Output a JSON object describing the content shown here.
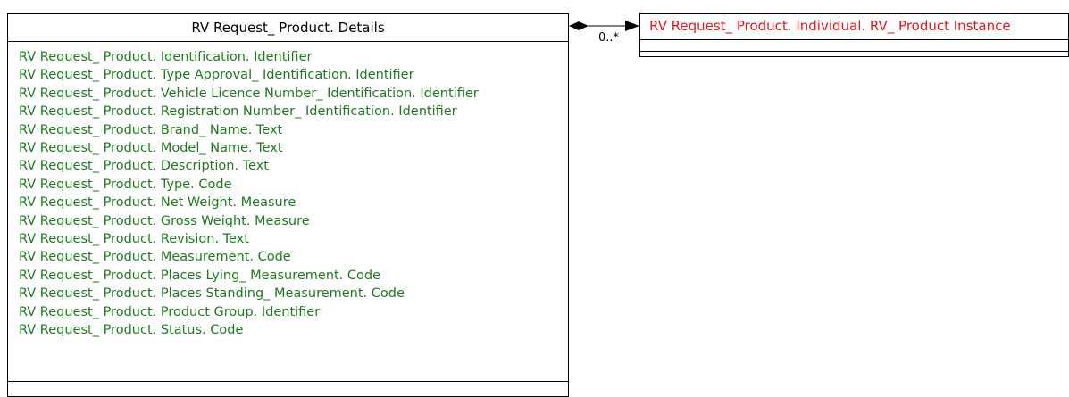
{
  "colors": {
    "attribute": "#1e7a1e",
    "target_class": "#e8141a",
    "line": "#000000"
  },
  "main_class": {
    "name": "RV Request_ Product. Details",
    "attributes": [
      "RV Request_ Product. Identification. Identifier",
      "RV Request_ Product. Type Approval_ Identification. Identifier",
      "RV Request_ Product. Vehicle Licence Number_ Identification. Identifier",
      "RV Request_ Product. Registration Number_ Identification. Identifier",
      "RV Request_ Product. Brand_ Name. Text",
      "RV Request_ Product. Model_ Name. Text",
      "RV Request_ Product. Description. Text",
      "RV Request_ Product. Type. Code",
      "RV Request_ Product. Net Weight. Measure",
      "RV Request_ Product. Gross Weight. Measure",
      "RV Request_ Product. Revision. Text",
      "RV Request_ Product. Measurement. Code",
      "RV Request_ Product. Places Lying_ Measurement. Code",
      "RV Request_ Product. Places Standing_ Measurement. Code",
      "RV Request_ Product. Product Group. Identifier",
      "RV Request_ Product. Status. Code"
    ]
  },
  "target_class": {
    "name": "RV Request_ Product. Individual. RV_ Product Instance"
  },
  "association": {
    "multiplicity": "0..*",
    "source_end": "composition-diamond",
    "target_end": "arrow"
  }
}
